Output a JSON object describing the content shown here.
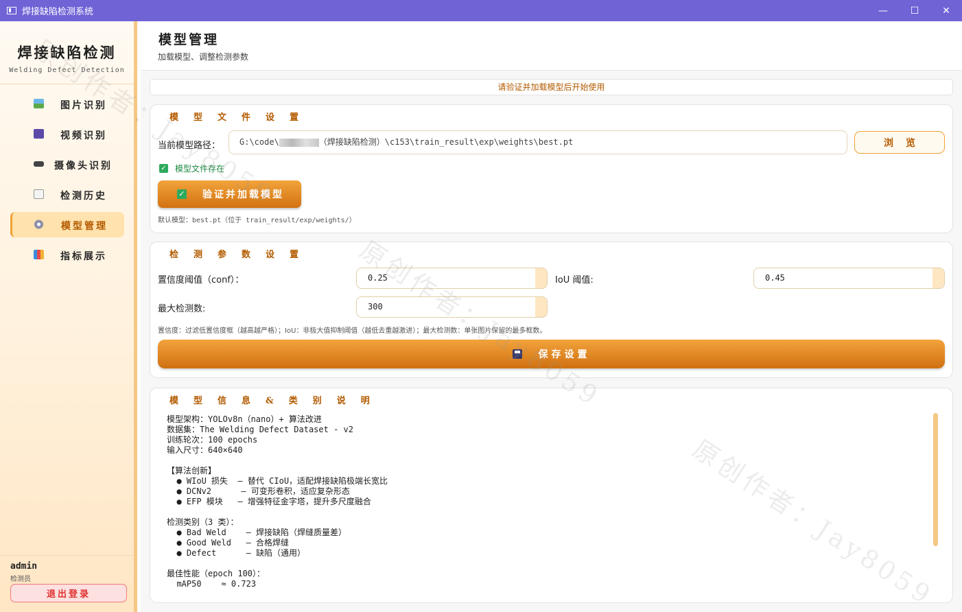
{
  "window": {
    "title": "焊接缺陷检测系统",
    "controls": {
      "minimize": "—",
      "maximize": "☐",
      "close": "✕"
    }
  },
  "sidebar": {
    "brand_title": "焊接缺陷检测",
    "brand_subtitle": "Welding Defect Detection",
    "items": [
      {
        "label": "图片识别",
        "icon": "image-icon"
      },
      {
        "label": "视频识别",
        "icon": "video-icon"
      },
      {
        "label": "摄像头识别",
        "icon": "camera-icon"
      },
      {
        "label": "检测历史",
        "icon": "history-icon"
      },
      {
        "label": "模型管理",
        "icon": "gear-icon",
        "active": true
      },
      {
        "label": "指标展示",
        "icon": "chart-icon"
      }
    ],
    "user": {
      "name": "admin",
      "role": "检测员",
      "logout_label": "退出登录"
    }
  },
  "header": {
    "title": "模型管理",
    "subtitle": "加载模型、调整检测参数"
  },
  "status": "请验证并加载模型后开始使用",
  "model_file": {
    "section_title": "模型文件设置",
    "path_label": "当前模型路径：",
    "path_prefix": "G:\\code\\",
    "path_suffix": "（焊接缺陷检测）\\c153\\train_result\\exp\\weights\\best.pt",
    "browse_label": "浏览",
    "exists_text": "模型文件存在",
    "verify_label": "验证并加载模型",
    "default_hint": "默认模型：best.pt（位于 train_result/exp/weights/）"
  },
  "detection_params": {
    "section_title": "检测参数设置",
    "conf_label": "置信度阈值（conf）：",
    "conf_value": "0.25",
    "iou_label": "IoU 阈值:",
    "iou_value": "0.45",
    "max_label": "最大检测数:",
    "max_value": "300",
    "hint": "置信度：过滤低置信度框（越高越严格）；IoU：非极大值抑制阈值（越低去重越激进）；最大检测数：单张图片保留的最多框数。",
    "save_label": "保存设置"
  },
  "model_info": {
    "section_title": "模型信息&类别说明",
    "text": "模型架构：YOLOv8n（nano）+ 算法改进\n数据集：The Welding Defect Dataset - v2\n训练轮次：100 epochs\n输入尺寸：640×640\n\n【算法创新】\n  ● WIoU 损失  — 替代 CIoU，适配焊接缺陷极端长宽比\n  ● DCNv2      — 可变形卷积，适应复杂形态\n  ● EFP 模块   — 增强特征金字塔，提升多尺度融合\n\n检测类别（3 类）：\n  ● Bad Weld    — 焊接缺陷（焊缝质量差）\n  ● Good Weld   — 合格焊缝\n  ● Defect      — 缺陷（通用）\n\n最佳性能（epoch 100）：\n  mAP50    ≈ 0.723"
  },
  "watermark": "原创作者：Jay8059"
}
